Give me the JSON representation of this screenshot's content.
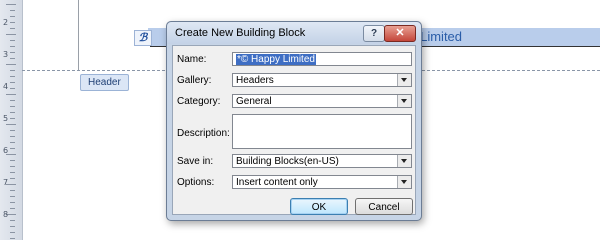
{
  "document": {
    "header_tag": "Header",
    "header_text_visible": "y Limited"
  },
  "dialog": {
    "title": "Create New Building Block",
    "help_glyph": "?",
    "close_glyph": "✕",
    "fields": {
      "name": {
        "label": "Name:",
        "value": "*© Happy Limited"
      },
      "gallery": {
        "label": "Gallery:",
        "value": "Headers"
      },
      "category": {
        "label": "Category:",
        "value": "General"
      },
      "description": {
        "label": "Description:",
        "value": ""
      },
      "save_in": {
        "label": "Save in:",
        "value": "Building Blocks(en-US)"
      },
      "options": {
        "label": "Options:",
        "value": "Insert content only"
      }
    },
    "ok_label": "OK",
    "cancel_label": "Cancel"
  },
  "ruler": {
    "numbers": [
      "2",
      "3",
      "4",
      "5",
      "6",
      "7",
      "8"
    ]
  },
  "colors": {
    "selection": "#3e6ec4",
    "header_highlight": "#b9cdeb",
    "dialog_frame": "#c6d4e6",
    "close_button": "#c4463a"
  }
}
